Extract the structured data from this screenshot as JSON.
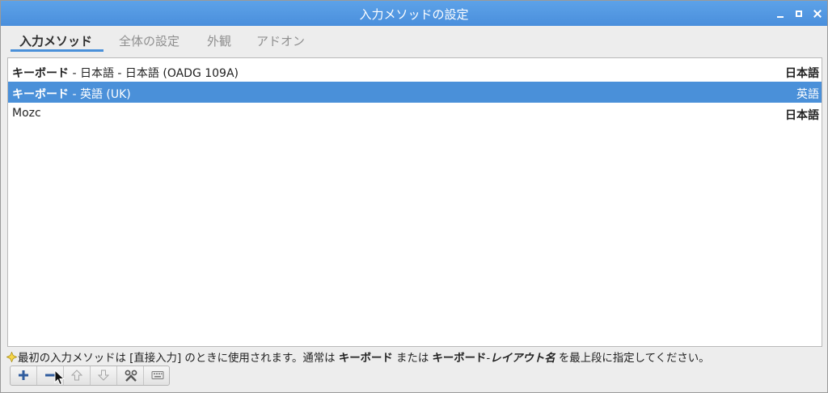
{
  "window": {
    "title": "入力メソッドの設定"
  },
  "tabs": [
    {
      "label": "入力メソッド",
      "active": true
    },
    {
      "label": "全体の設定",
      "active": false
    },
    {
      "label": "外観",
      "active": false
    },
    {
      "label": "アドオン",
      "active": false
    }
  ],
  "im_list": [
    {
      "name_bold": "キーボード",
      "name_rest": " - 日本語 - 日本語 (OADG 109A)",
      "lang": "日本語",
      "selected": false
    },
    {
      "name_bold": "キーボード",
      "name_rest": " - 英語 (UK)",
      "lang": "英語",
      "selected": true
    },
    {
      "name_bold": "",
      "name_rest": "Mozc",
      "lang": "日本語",
      "selected": false
    }
  ],
  "hint": {
    "part1": "最初の入力メソッドは [直接入力] のときに使用されます。通常は ",
    "bold1": "キーボード",
    "part2": " または ",
    "bold2": "キーボード",
    "bold2b": "-",
    "italic_bold": "レイアウト名",
    "part3": " を最上段に指定してください。"
  },
  "toolbar": {
    "buttons": [
      "add-icon",
      "remove-icon",
      "move-up-icon",
      "move-down-icon",
      "configure-icon",
      "keyboard-layout-icon"
    ]
  },
  "colors": {
    "titlebar": "#4a8fdc",
    "accent": "#4a90d9"
  }
}
